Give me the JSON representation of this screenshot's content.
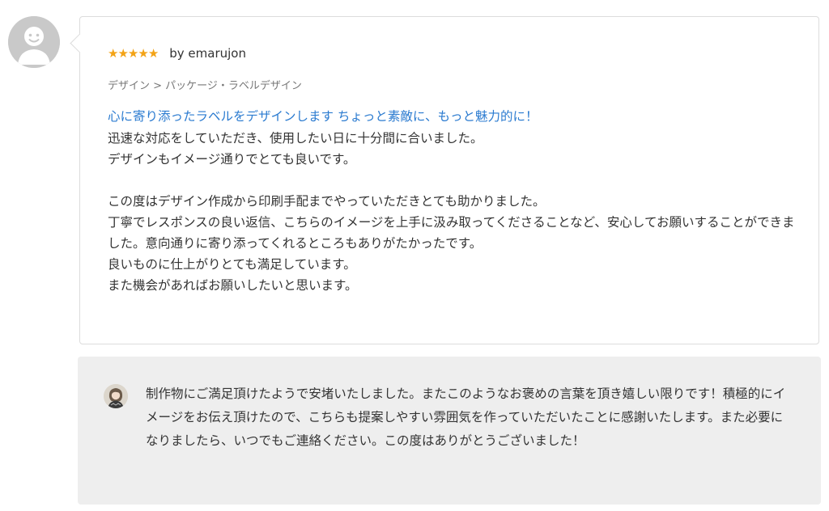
{
  "reviewer": {
    "avatar_icon": "default-user-avatar-icon",
    "rating": 5,
    "rating_max": 5,
    "star_color": "#f3a316",
    "byline": "by emarujon"
  },
  "review": {
    "category": "デザイン > パッケージ・ラベルデザイン",
    "title": "心に寄り添ったラベルをデザインします ちょっと素敵に、もっと魅力的に！",
    "title_color": "#2b7bd0",
    "body": "迅速な対応をしていただき、使用したい日に十分間に合いました。\nデザインもイメージ通りでとても良いです。\n\nこの度はデザイン作成から印刷手配までやっていただきとても助かりました。\n丁寧でレスポンスの良い返信、こちらのイメージを上手に汲み取ってくださることなど、安心してお願いすることができました。意向通りに寄り添ってくれるところもありがたかったです。\n良いものに仕上がりとても満足しています。\nまた機会があればお願いしたいと思います。"
  },
  "reply": {
    "avatar_icon": "seller-avatar-icon",
    "text": "制作物にご満足頂けたようで安堵いたしました。またこのようなお褒めの言葉を頂き嬉しい限りです！積極的にイメージをお伝え頂けたので、こちらも提案しやすい雰囲気を作っていただいたことに感謝いたします。また必要になりましたら、いつでもご連絡ください。この度はありがとうございました！"
  }
}
